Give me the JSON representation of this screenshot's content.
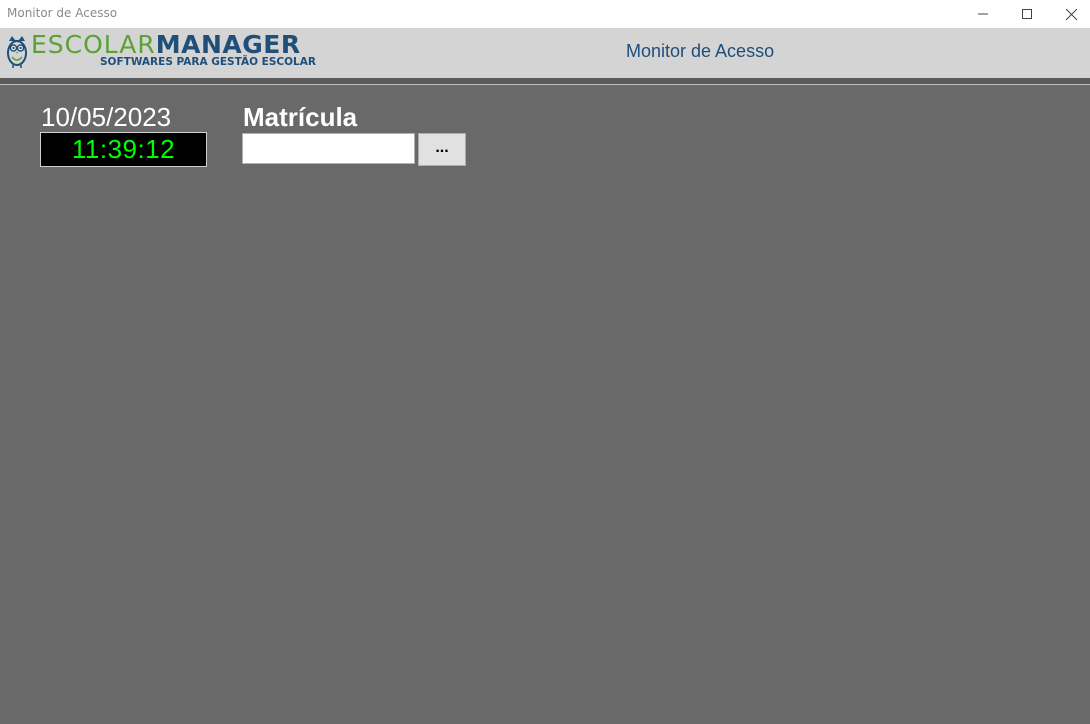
{
  "window": {
    "title": "Monitor de Acesso",
    "controls": {
      "minimize_icon": "minimize-icon",
      "maximize_icon": "maximize-icon",
      "close_icon": "close-icon"
    }
  },
  "header": {
    "logo": {
      "brand_part1": "ESCOLAR",
      "brand_part2": "MANAGER",
      "tagline": "SOFTWARES PARA GESTÃO ESCOLAR",
      "icon": "owl-icon"
    },
    "title": "Monitor de Acesso"
  },
  "main": {
    "date": "10/05/2023",
    "time": "11:39:12",
    "matricula_label": "Matrícula",
    "matricula_value": "",
    "browse_button": "..."
  },
  "colors": {
    "background": "#696969",
    "header_bg": "#d4d4d4",
    "brand_green": "#5aa235",
    "brand_blue": "#1f4e79",
    "clock_bg": "#000000",
    "clock_text": "#00ff00"
  }
}
